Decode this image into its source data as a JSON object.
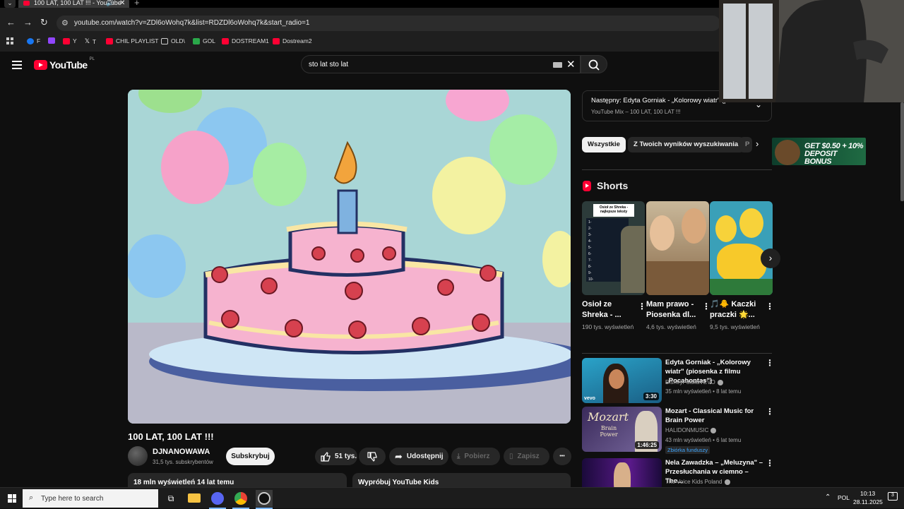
{
  "browser": {
    "tab_title": "100 LAT, 100 LAT !!! - YouTube",
    "new_tab_glyph": "+",
    "url": "youtube.com/watch?v=ZDl6oWohq7k&list=RDZDl6oWohq7k&start_radio=1",
    "bookmarks": [
      {
        "label": "F",
        "icon": "facebook-icon",
        "color": "#1877f2"
      },
      {
        "label": "",
        "icon": "twitch-icon",
        "color": "#9146ff"
      },
      {
        "label": "Y",
        "icon": "youtube-icon",
        "color": "#ff0033"
      },
      {
        "label": "T",
        "icon": "x-icon",
        "color": "#ffffff"
      },
      {
        "label": "CHIL PLAYLIST",
        "icon": "youtube-icon",
        "color": "#ff0033"
      },
      {
        "label": "OLD\\",
        "icon": "folder-icon",
        "color": "#cccccc"
      },
      {
        "label": "GOL",
        "icon": "gol-icon",
        "color": "#2aa84a"
      },
      {
        "label": "DOSTREAM1",
        "icon": "youtube-icon",
        "color": "#ff0033"
      },
      {
        "label": "Dostream2",
        "icon": "youtube-icon",
        "color": "#ff0033"
      }
    ]
  },
  "youtube": {
    "logo_text": "YouTube",
    "region": "PL",
    "search_query": "sto lat sto lat",
    "accent": "#ff0033"
  },
  "video": {
    "title": "100 LAT, 100 LAT !!!",
    "channel": "DJNANOWAWA",
    "subscribers": "31,5 tys. subskrybentów",
    "subscribe_label": "Subskrybuj",
    "likes": "51 tys.",
    "share_label": "Udostępnij",
    "download_label": "Pobierz",
    "save_label": "Zapisz",
    "more_glyph": "•••",
    "views_date": "18 mln wyświetleń  14 lat temu",
    "kids_promo": "Wypróbuj YouTube Kids"
  },
  "sidebar": {
    "next_label": "Następny: Edyta Gorniak - „Kolorowy wiatr\" (piosenka",
    "mix_label": "YouTube Mix – 100 LAT, 100 LAT !!!",
    "chips": [
      "Wszystkie",
      "Z Twoich wyników wyszukiwania",
      "P"
    ],
    "shorts_header": "Shorts",
    "shorts": [
      {
        "title": "Osioł ze Shreka - ...",
        "views": "190 tys. wyświetleń",
        "thumb_caption": "Osioł ze Shreka - najlepsze teksty",
        "thumb_numbers": [
          "1-",
          "2-",
          "3-",
          "4-",
          "5-",
          "6-",
          "7-",
          "8-",
          "9-",
          "10-"
        ]
      },
      {
        "title": "Mam prawo - Piosenka dl...",
        "views": "4,6 tys. wyświetleń"
      },
      {
        "title": "🎵🐥 Kaczki praczki 🌟...",
        "views": "9,5 tys. wyświetleń"
      }
    ],
    "recs": [
      {
        "title": "Edyta Gorniak - „Kolorowy wiatr\" (piosenka z filmu „Pocahontas\")",
        "channel": "DisneyPolskaVEVO",
        "meta": "35 mln wyświetleń • 8 lat temu",
        "duration": "3:30",
        "thumb_watermark": "vevo"
      },
      {
        "title": "Mozart - Classical Music for Brain Power",
        "channel": "HALIDONMUSIC",
        "meta": "43 mln wyświetleń • 6 lat temu",
        "duration": "1:46:25",
        "badge": "Zbiórka funduszy",
        "thumb_title": "Mozart",
        "thumb_subtitle": "Brain Power"
      },
      {
        "title": "Nela Zawadzka – „Meluzyna\" – Przesłuchania w ciemno – The...",
        "channel": "The Voice Kids Poland",
        "meta": "",
        "duration": ""
      }
    ],
    "ad_text": "GET $0.50 + 10% DEPOSIT BONUS"
  },
  "taskbar": {
    "search_placeholder": "Type here to search",
    "lang": "POL",
    "time": "10:13",
    "date": "28.11.2025",
    "notification_count": "3"
  }
}
